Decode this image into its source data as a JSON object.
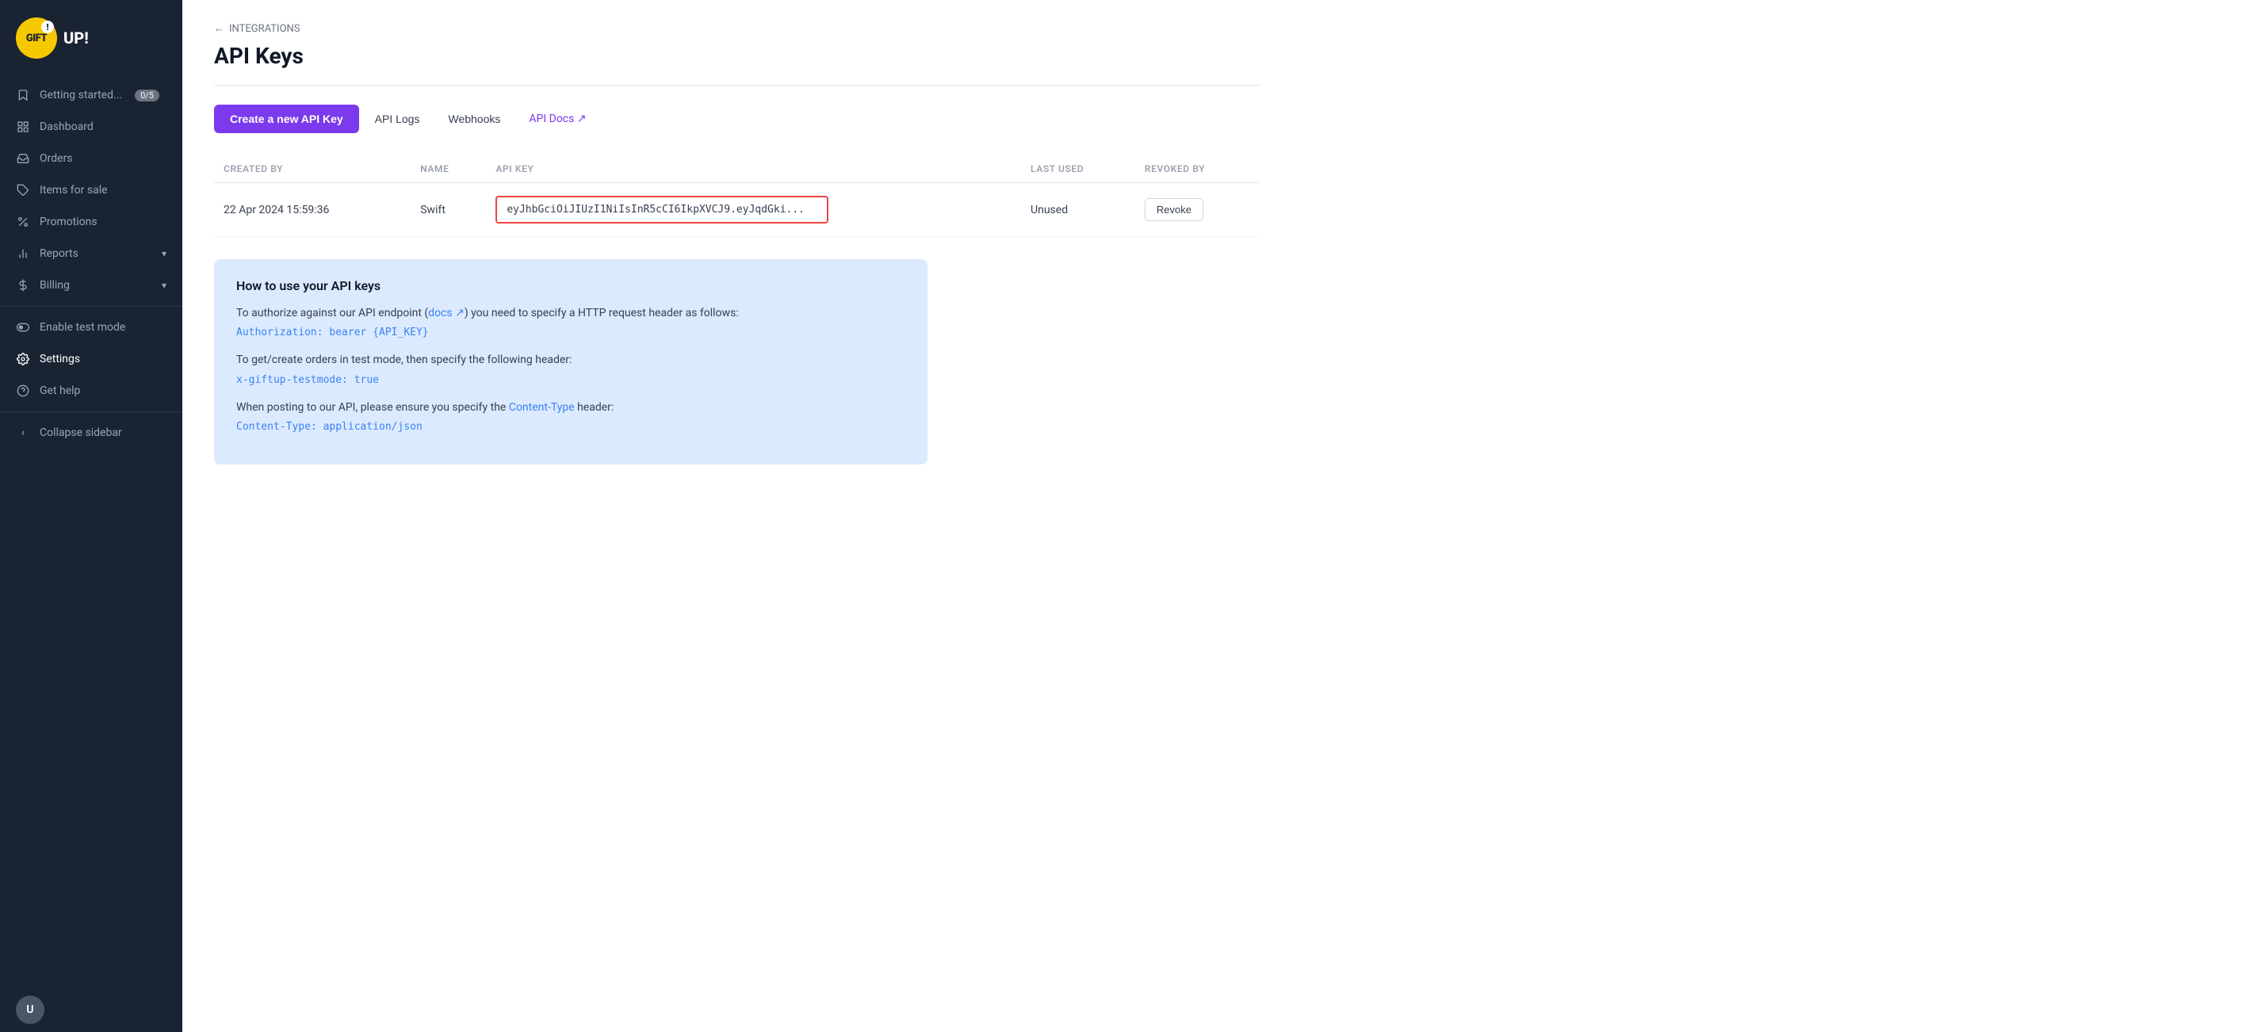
{
  "sidebar": {
    "logo": {
      "text": "GIFT",
      "exclaim": "!",
      "full_label": "GIFT UP!"
    },
    "nav_items": [
      {
        "id": "getting-started",
        "label": "Getting started...",
        "icon": "bookmark",
        "badge": "0/5"
      },
      {
        "id": "dashboard",
        "label": "Dashboard",
        "icon": "grid"
      },
      {
        "id": "orders",
        "label": "Orders",
        "icon": "inbox"
      },
      {
        "id": "items-for-sale",
        "label": "Items for sale",
        "icon": "tag"
      },
      {
        "id": "promotions",
        "label": "Promotions",
        "icon": "percent"
      },
      {
        "id": "reports",
        "label": "Reports",
        "icon": "bar-chart",
        "chevron": "▾"
      },
      {
        "id": "billing",
        "label": "Billing",
        "icon": "dollar",
        "chevron": "▾"
      },
      {
        "id": "enable-test-mode",
        "label": "Enable test mode",
        "icon": "toggle"
      },
      {
        "id": "settings",
        "label": "Settings",
        "icon": "gear",
        "active": true
      },
      {
        "id": "get-help",
        "label": "Get help",
        "icon": "help-circle"
      }
    ],
    "collapse_label": "Collapse sidebar"
  },
  "breadcrumb": {
    "parent": "INTEGRATIONS",
    "arrow": "←"
  },
  "page_title": "API Keys",
  "tabs": [
    {
      "id": "create",
      "label": "Create a new API Key",
      "primary": true
    },
    {
      "id": "api-logs",
      "label": "API Logs",
      "primary": false
    },
    {
      "id": "webhooks",
      "label": "Webhooks",
      "primary": false
    },
    {
      "id": "api-docs",
      "label": "API Docs ↗",
      "link": true
    }
  ],
  "table": {
    "columns": [
      {
        "id": "created_by",
        "label": "CREATED BY"
      },
      {
        "id": "name",
        "label": "NAME"
      },
      {
        "id": "api_key",
        "label": "API KEY"
      },
      {
        "id": "last_used",
        "label": "LAST USED"
      },
      {
        "id": "revoked_by",
        "label": "REVOKED BY"
      }
    ],
    "rows": [
      {
        "created_by": "22 Apr 2024 15:59:36",
        "name": "Swift",
        "api_key": "eyJhbGciOiJIUzI1NiIsInR5cCI6IkpXVCJ9.eyJqdGki...",
        "last_used": "Unused",
        "revoke_label": "Revoke"
      }
    ]
  },
  "info_box": {
    "title": "How to use your API keys",
    "paragraph1_before": "To authorize against our API endpoint (",
    "paragraph1_link": "docs ↗",
    "paragraph1_after": ") you need to specify a HTTP request header as follows:",
    "code1": "Authorization: bearer {API_KEY}",
    "paragraph2": "To get/create orders in test mode, then specify the following header:",
    "code2": "x-giftup-testmode: true",
    "paragraph3_before": "When posting to our API, please ensure you specify the ",
    "paragraph3_link": "Content-Type",
    "paragraph3_after": " header:",
    "code3": "Content-Type: application/json"
  }
}
